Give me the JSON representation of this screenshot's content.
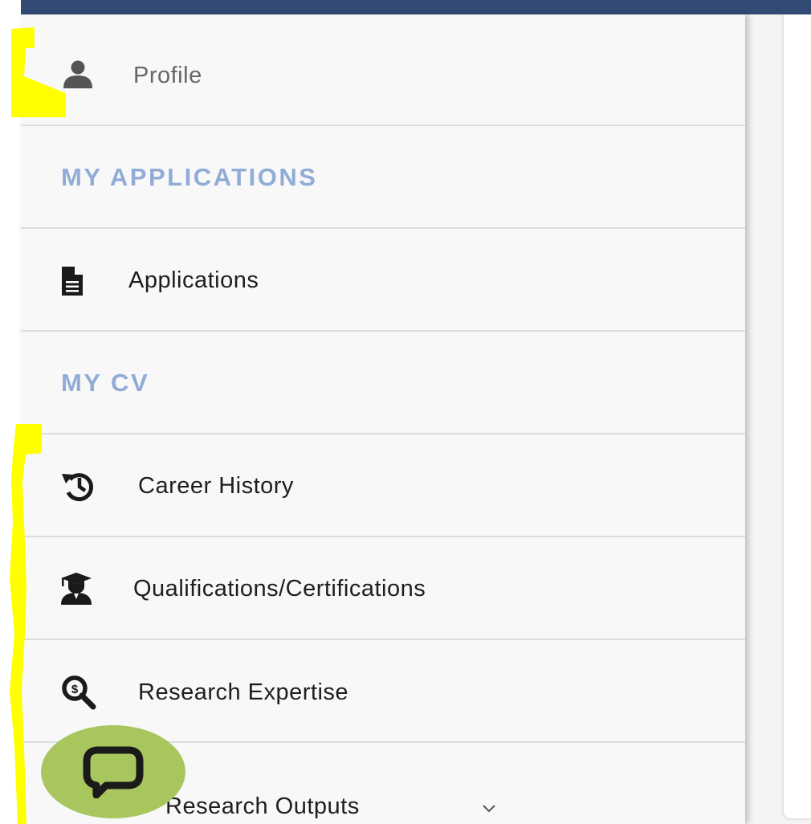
{
  "nav": {
    "profile": {
      "label": "Profile",
      "icon": "user-icon"
    },
    "my_applications_header": "MY APPLICATIONS",
    "applications": {
      "label": "Applications",
      "icon": "document-icon"
    },
    "my_cv_header": "MY CV",
    "career_history": {
      "label": "Career History",
      "icon": "history-icon"
    },
    "qualifications": {
      "label": "Qualifications/Certifications",
      "icon": "graduate-icon"
    },
    "research_expertise": {
      "label": "Research Expertise",
      "icon": "dollar-search-icon"
    },
    "research_outputs": {
      "label": "Research Outputs",
      "icon": "chevron-down-icon"
    }
  },
  "chat": {
    "icon": "chat-bubble-icon"
  },
  "colors": {
    "topbar": "#334b74",
    "section_header": "#91acd6",
    "chat_button": "#a8c65e",
    "highlight_marker": "#ffff00"
  }
}
